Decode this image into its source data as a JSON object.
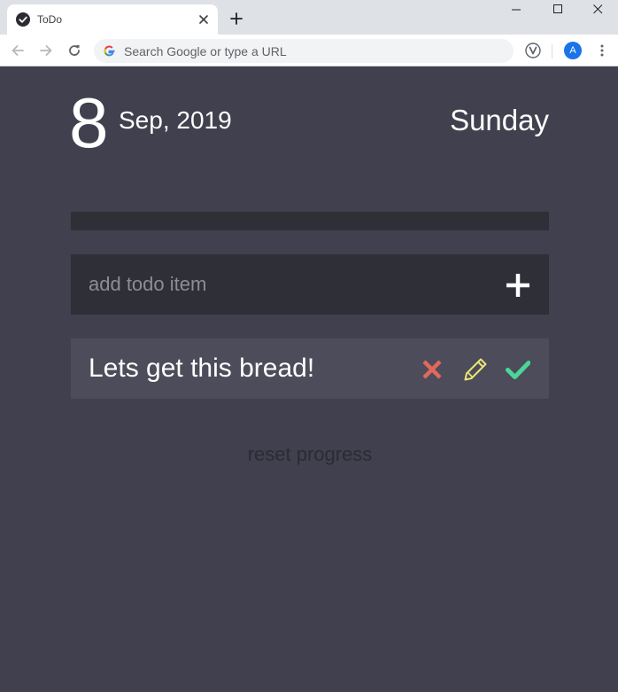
{
  "browser": {
    "tab_title": "ToDo",
    "favicon": "check-circle-icon",
    "omnibox_placeholder": "Search Google or type a URL",
    "profile_initial": "A"
  },
  "date": {
    "day": "8",
    "month_year": "Sep, 2019",
    "weekday": "Sunday"
  },
  "progress": {
    "fraction": 0.0
  },
  "add_todo": {
    "placeholder": "add todo item",
    "button_icon": "plus-icon"
  },
  "todos": [
    {
      "text": "Lets get this bread!",
      "actions": [
        "close-icon",
        "pencil-icon",
        "check-icon"
      ]
    }
  ],
  "reset_label": "reset progress",
  "colors": {
    "background": "#40404e",
    "panel_dark": "#2f2f37",
    "item_bg": "#4c4c5a",
    "delete": "#e0685c",
    "edit": "#ece577",
    "done": "#4dd599",
    "reset_text": "#2b2b33"
  }
}
